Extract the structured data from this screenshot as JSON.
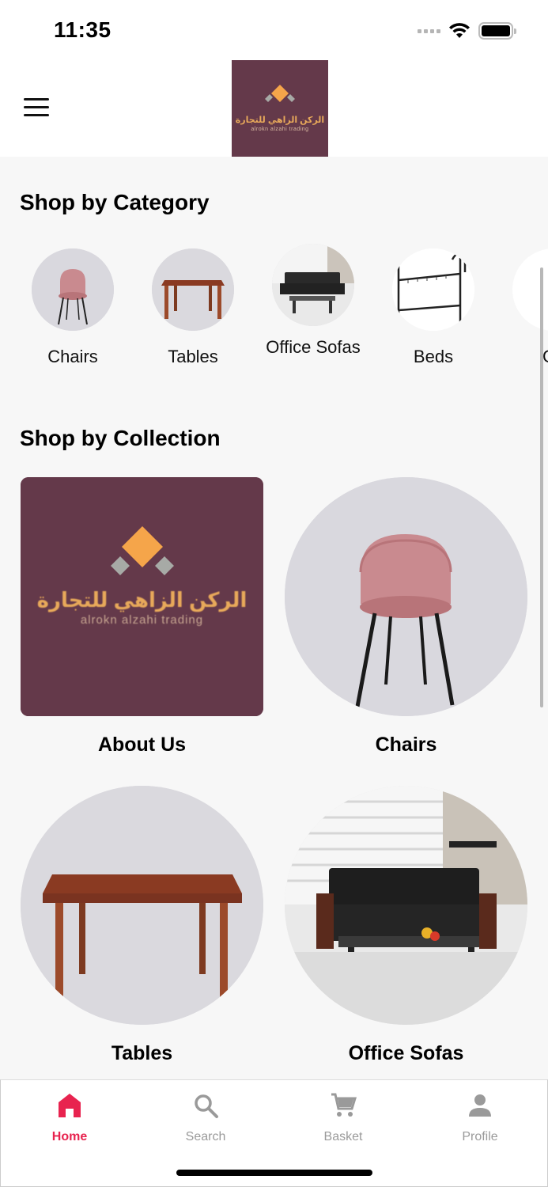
{
  "status": {
    "time": "11:35"
  },
  "header": {
    "logo_arabic": "الركن الزاهي للتجارة",
    "logo_latin": "alrokn alzahi trading"
  },
  "category_section": {
    "title": "Shop by Category",
    "items": [
      {
        "label": "Chairs",
        "icon": "chair-image"
      },
      {
        "label": "Tables",
        "icon": "table-image"
      },
      {
        "label": "Office Sofas",
        "icon": "sofa-image"
      },
      {
        "label": "Beds",
        "icon": "bed-image"
      },
      {
        "label": "Cu",
        "icon": "partial-category-image"
      }
    ]
  },
  "collection_section": {
    "title": "Shop by Collection",
    "items": [
      {
        "label": "About Us"
      },
      {
        "label": "Chairs"
      },
      {
        "label": "Tables"
      },
      {
        "label": "Office Sofas"
      }
    ]
  },
  "tabs": [
    {
      "label": "Home",
      "icon": "home-icon",
      "active": true
    },
    {
      "label": "Search",
      "icon": "search-icon",
      "active": false
    },
    {
      "label": "Basket",
      "icon": "cart-icon",
      "active": false
    },
    {
      "label": "Profile",
      "icon": "person-icon",
      "active": false
    }
  ],
  "colors": {
    "brand": "#64394a",
    "accent": "#e8234f",
    "logo_orange": "#f5a54a"
  }
}
